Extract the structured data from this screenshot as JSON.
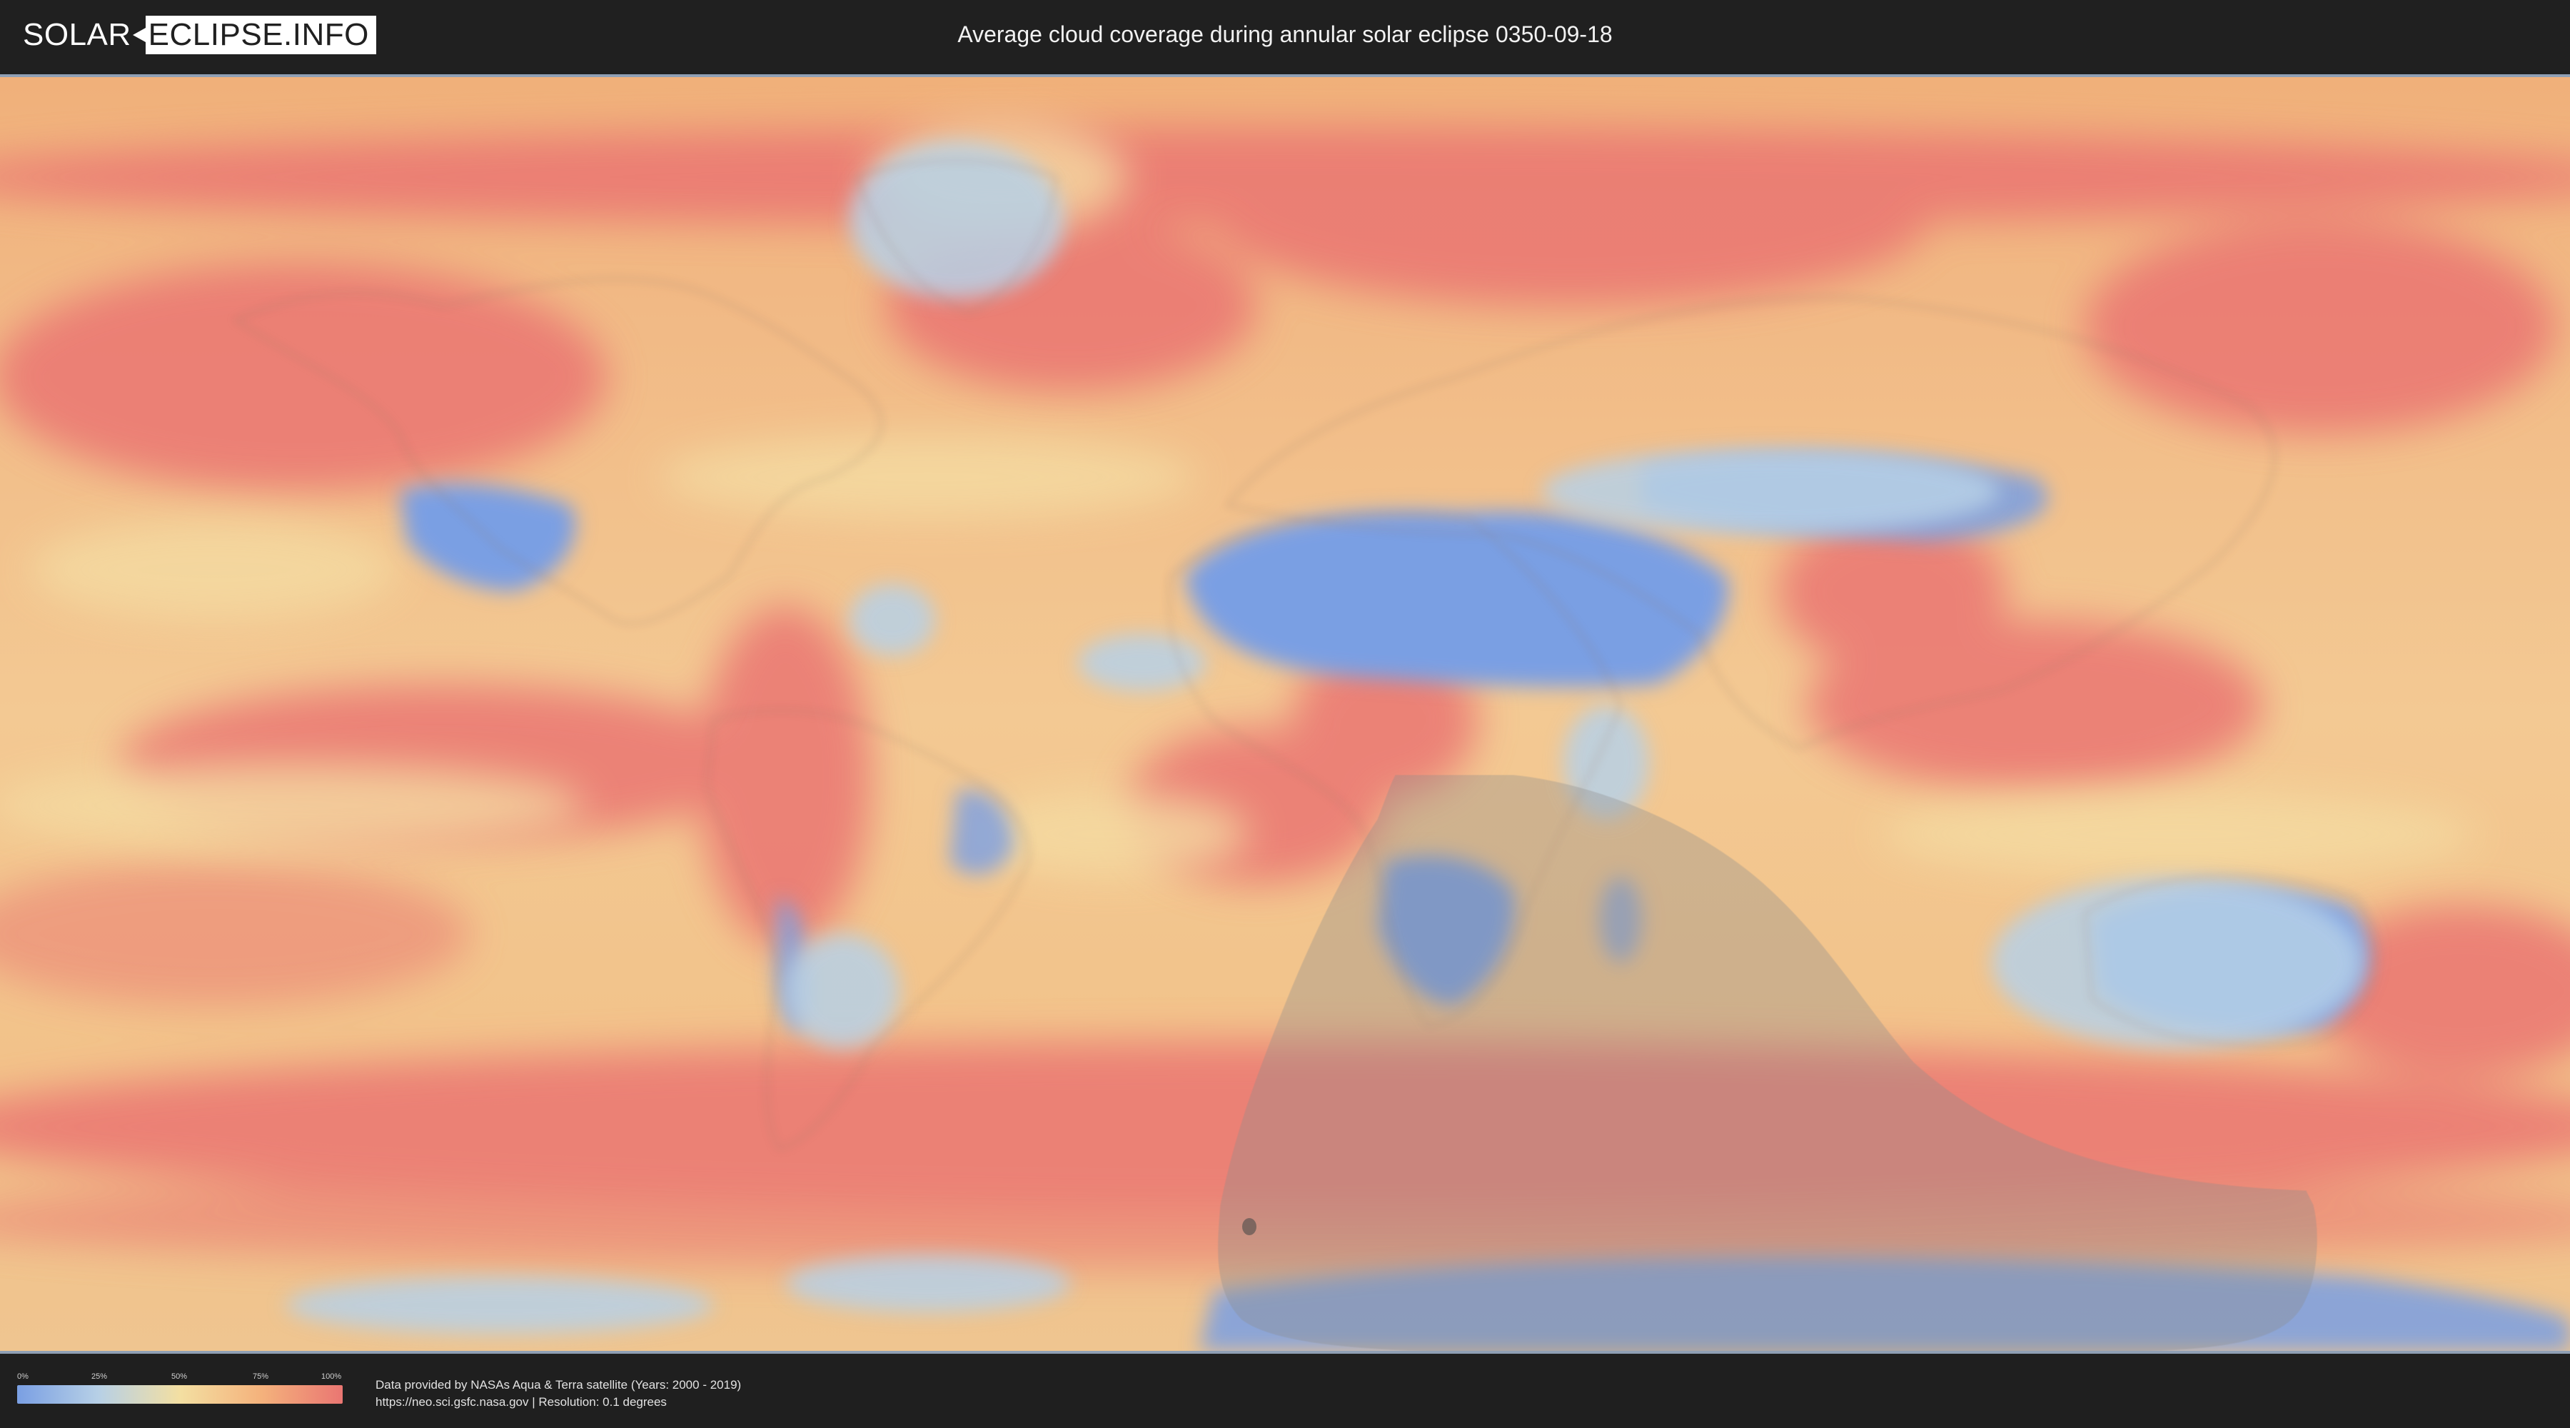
{
  "header": {
    "logo_part1": "SOLAR",
    "logo_part2": "ECLIPSE.INFO",
    "title": "Average cloud coverage during annular solar eclipse 0350-09-18"
  },
  "colors": {
    "background": "#1f1f1f",
    "clear_sky": "#7a9fe3",
    "quarter": "#b7d0e6",
    "half": "#f3dfa2",
    "three_quarters": "#f4b27c",
    "overcast": "#ea7672",
    "eclipse_shadow": "#8e8e8e",
    "map_border": "#8f9fb4"
  },
  "map": {
    "projection": "equirectangular",
    "eclipse_type": "annular",
    "eclipse_date": "0350-09-18",
    "overlay": "shaded eclipse visibility region"
  },
  "legend": {
    "labels": [
      "0%",
      "25%",
      "50%",
      "75%",
      "100%"
    ],
    "gradient_colors": [
      "#7a9fe3",
      "#b7d0e6",
      "#f3dfa2",
      "#f4b27c",
      "#ea7672"
    ]
  },
  "footer": {
    "credit_line1": "Data provided by NASAs Aqua & Terra satellite (Years: 2000 - 2019)",
    "credit_line2": "https://neo.sci.gsfc.nasa.gov | Resolution: 0.1 degrees"
  }
}
